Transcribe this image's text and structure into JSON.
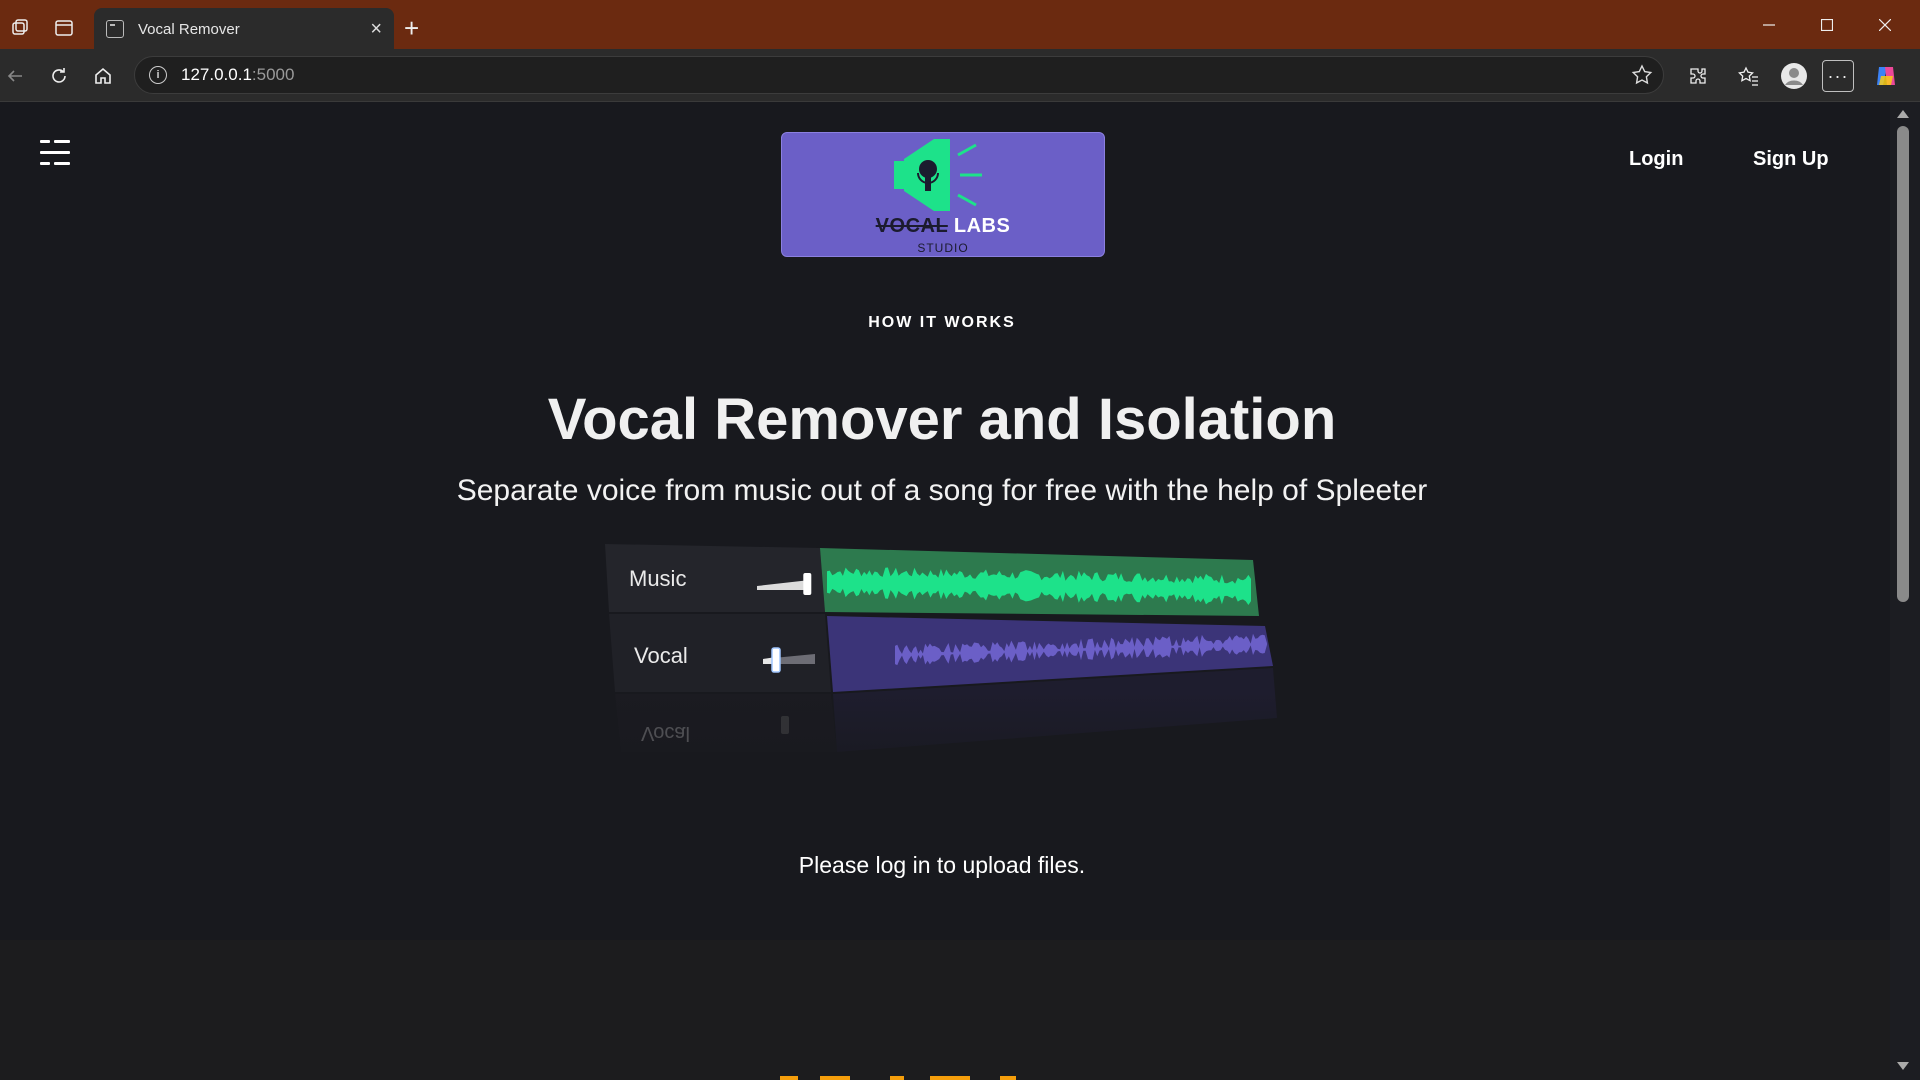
{
  "browser": {
    "tab_title": "Vocal Remover",
    "url_host": "127.0.0.1",
    "url_port": ":5000",
    "titlebar_color": "#6b2a10"
  },
  "header": {
    "login_label": "Login",
    "signup_label": "Sign Up"
  },
  "logo": {
    "word_strike": "VOCAL",
    "word_main": "LABS",
    "sub": "STUDIO",
    "bg_color": "#6b5fc7",
    "accent_color": "#1de28a"
  },
  "hero": {
    "section_label": "HOW IT WORKS",
    "title": "Vocal Remover and Isolation",
    "subtitle": "Separate voice from music out of a song for free with the help of Spleeter"
  },
  "mixer": {
    "tracks": [
      {
        "label": "Music",
        "color": "#1de28a",
        "level": 0.95
      },
      {
        "label": "Vocal",
        "color": "#6b5fc7",
        "level": 0.25
      }
    ],
    "reflection_label": "Vocal"
  },
  "main": {
    "notice": "Please log in to upload files."
  }
}
